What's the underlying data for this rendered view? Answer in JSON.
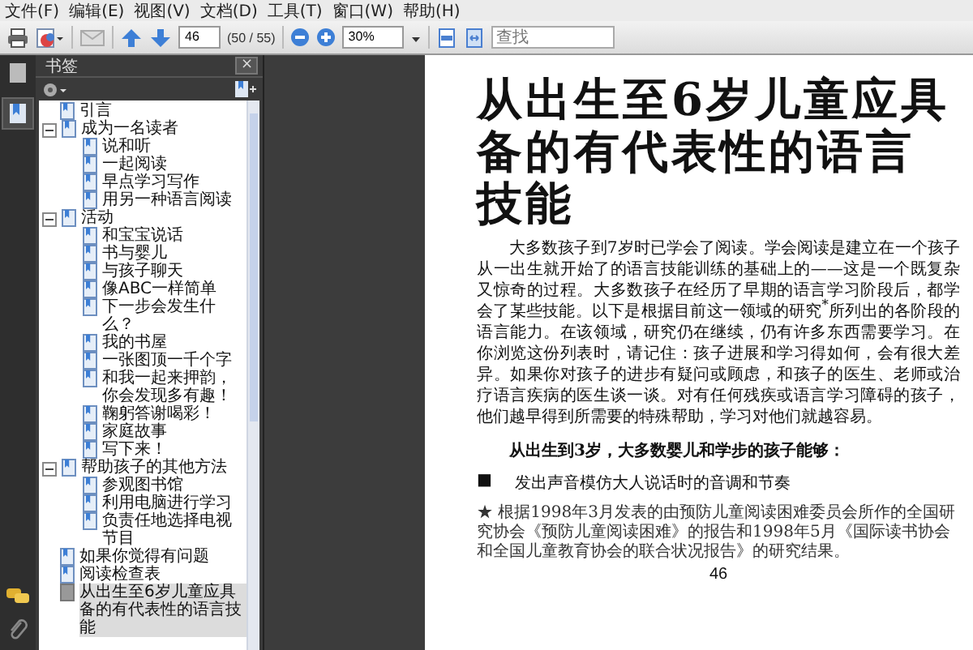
{
  "menu": [
    "文件(F)",
    "编辑(E)",
    "视图(V)",
    "文档(D)",
    "工具(T)",
    "窗口(W)",
    "帮助(H)"
  ],
  "toolbar": {
    "page": "46",
    "page_count": "(50 / 55)",
    "zoom": "30%",
    "search": {
      "placeholder": "查找"
    }
  },
  "bookmarks": {
    "title": "书签",
    "close": "×",
    "items": [
      {
        "label": "引言",
        "selected": false
      },
      {
        "label": "成为一名读者",
        "selected": false,
        "expanded": true,
        "children": [
          {
            "label": "说和听",
            "selected": false
          },
          {
            "label": "一起阅读",
            "selected": false
          },
          {
            "label": "早点学习写作",
            "selected": false
          },
          {
            "label": "用另一种语言阅读",
            "selected": false
          }
        ]
      },
      {
        "label": "活动",
        "selected": false,
        "expanded": true,
        "children": [
          {
            "label": "和宝宝说话",
            "selected": false
          },
          {
            "label": "书与婴儿",
            "selected": false
          },
          {
            "label": "与孩子聊天",
            "selected": false
          },
          {
            "label": "像ABC一样简单",
            "selected": false
          },
          {
            "label": "下一步会发生什么？",
            "selected": false
          },
          {
            "label": "我的书屋",
            "selected": false
          },
          {
            "label": "一张图顶一千个字",
            "selected": false
          },
          {
            "label": "和我一起来押韵，你会发现多有趣！",
            "selected": false
          },
          {
            "label": "鞠躬答谢喝彩！",
            "selected": false
          },
          {
            "label": "家庭故事",
            "selected": false
          },
          {
            "label": "写下来！",
            "selected": false
          }
        ]
      },
      {
        "label": "帮助孩子的其他方法",
        "selected": false,
        "expanded": true,
        "children": [
          {
            "label": "参观图书馆",
            "selected": false
          },
          {
            "label": "利用电脑进行学习",
            "selected": false
          },
          {
            "label": "负责任地选择电视节目",
            "selected": false
          }
        ]
      },
      {
        "label": "如果你觉得有问题",
        "selected": false
      },
      {
        "label": "阅读检查表",
        "selected": false
      },
      {
        "label": "从出生至6岁儿童应具备的有代表性的语言技能",
        "selected": true
      }
    ]
  },
  "document": {
    "title": "从出生至6岁儿童应具备的有代表性的语言技能",
    "paragraph": "大多数孩子到7岁时已学会了阅读。学会阅读是建立在一个孩子从一出生就开始了的语言技能训练的基础上的——这是一个既复杂又惊奇的过程。大多数孩子在经历了早期的语言学习阶段后，都学会了某些技能。以下是根据目前这一领域的研究$^{*}$所列出的各阶段的语言能力。在该领域，研究仍在继续，仍有许多东西需要学习。在你浏览这份列表时，请记住：孩子进展和学习得如何，会有很大差异。如果你对孩子的进步有疑问或顾虑，和孩子的医生、老师或治疗语言疾病的医生谈一谈。对有任何残疾或语言学习障碍的孩子，他们越早得到所需要的特殊帮助，学习对他们就越容易。",
    "heading": "从出生到3岁，大多数婴儿和学步的孩子能够：",
    "bullets": [
      {
        "marker": "■",
        "text": "发出声音模仿大人说话时的音调和节奏"
      }
    ],
    "footnote": "★ 根据1998年3月发表的由预防儿童阅读困难委员会所作的全国研究协会《预防儿童阅读困难》的报告和1998年5月《国际读书协会和全国儿童教育协会的联合状况报告》的研究结果。",
    "page_number": "46"
  }
}
